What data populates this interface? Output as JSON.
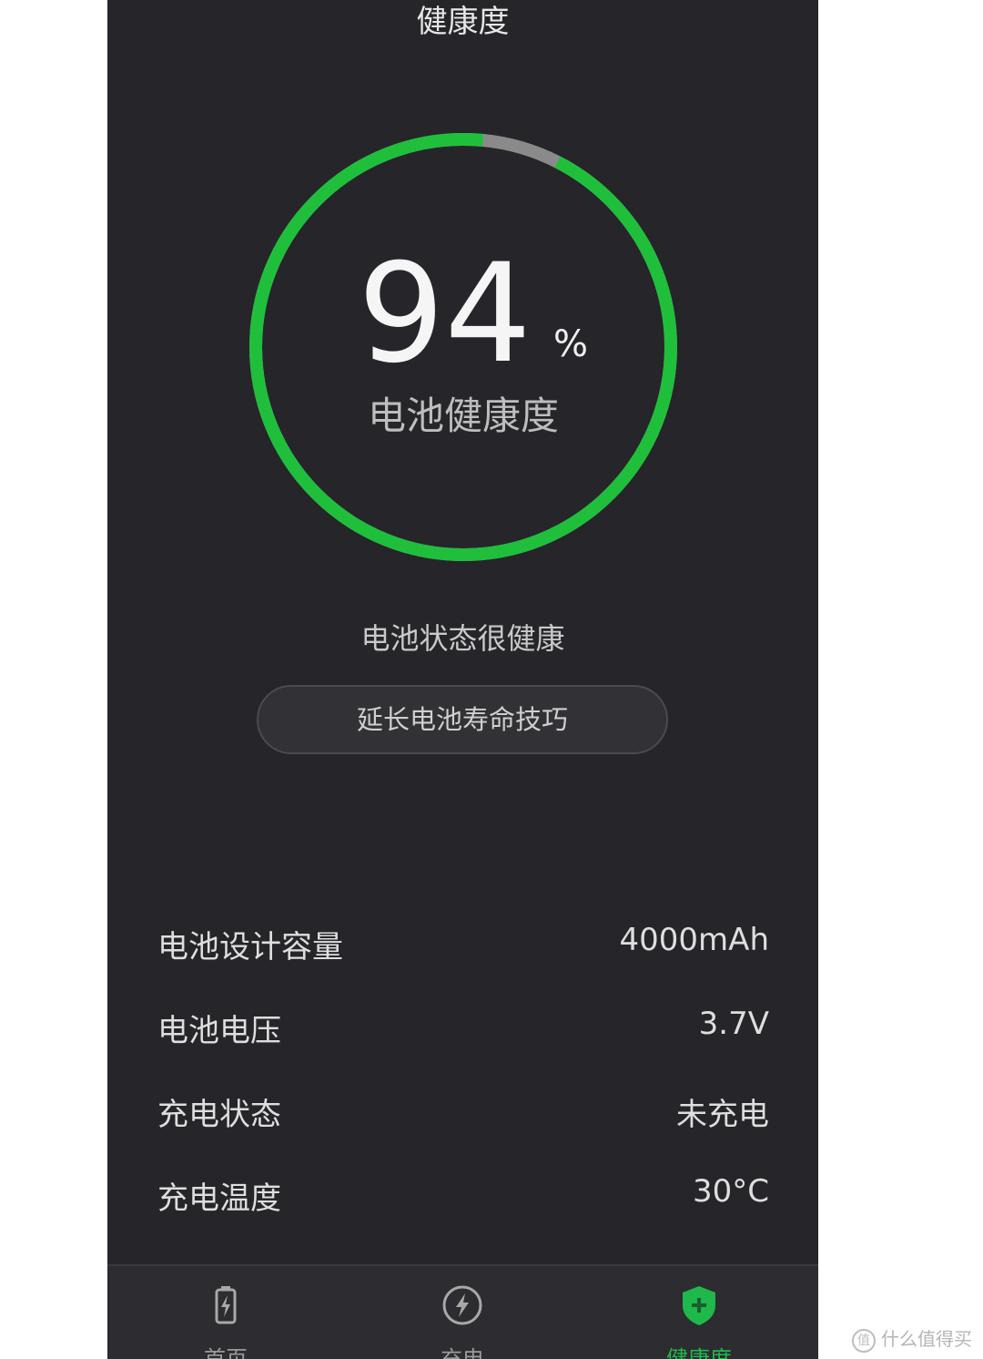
{
  "header": {
    "title": "健康度"
  },
  "health": {
    "value": "94",
    "unit": "%",
    "caption": "电池健康度",
    "percent": 94,
    "ring_color": "#1fbf3c",
    "track_color": "#8a8a8a"
  },
  "status": {
    "text": "电池状态很健康"
  },
  "tips_button": {
    "label": "延长电池寿命技巧"
  },
  "info": [
    {
      "label": "电池设计容量",
      "value": "4000mAh"
    },
    {
      "label": "电池电压",
      "value": "3.7V"
    },
    {
      "label": "充电状态",
      "value": "未充电"
    },
    {
      "label": "充电温度",
      "value": "30°C"
    }
  ],
  "tabs": [
    {
      "label": "首页",
      "icon": "battery-icon",
      "active": false
    },
    {
      "label": "充电",
      "icon": "charging-bolt-icon",
      "active": false
    },
    {
      "label": "健康度",
      "icon": "shield-plus-icon",
      "active": true
    }
  ],
  "accent_color": "#1fb84a",
  "watermark": {
    "text": "什么值得买",
    "mark": "值"
  }
}
